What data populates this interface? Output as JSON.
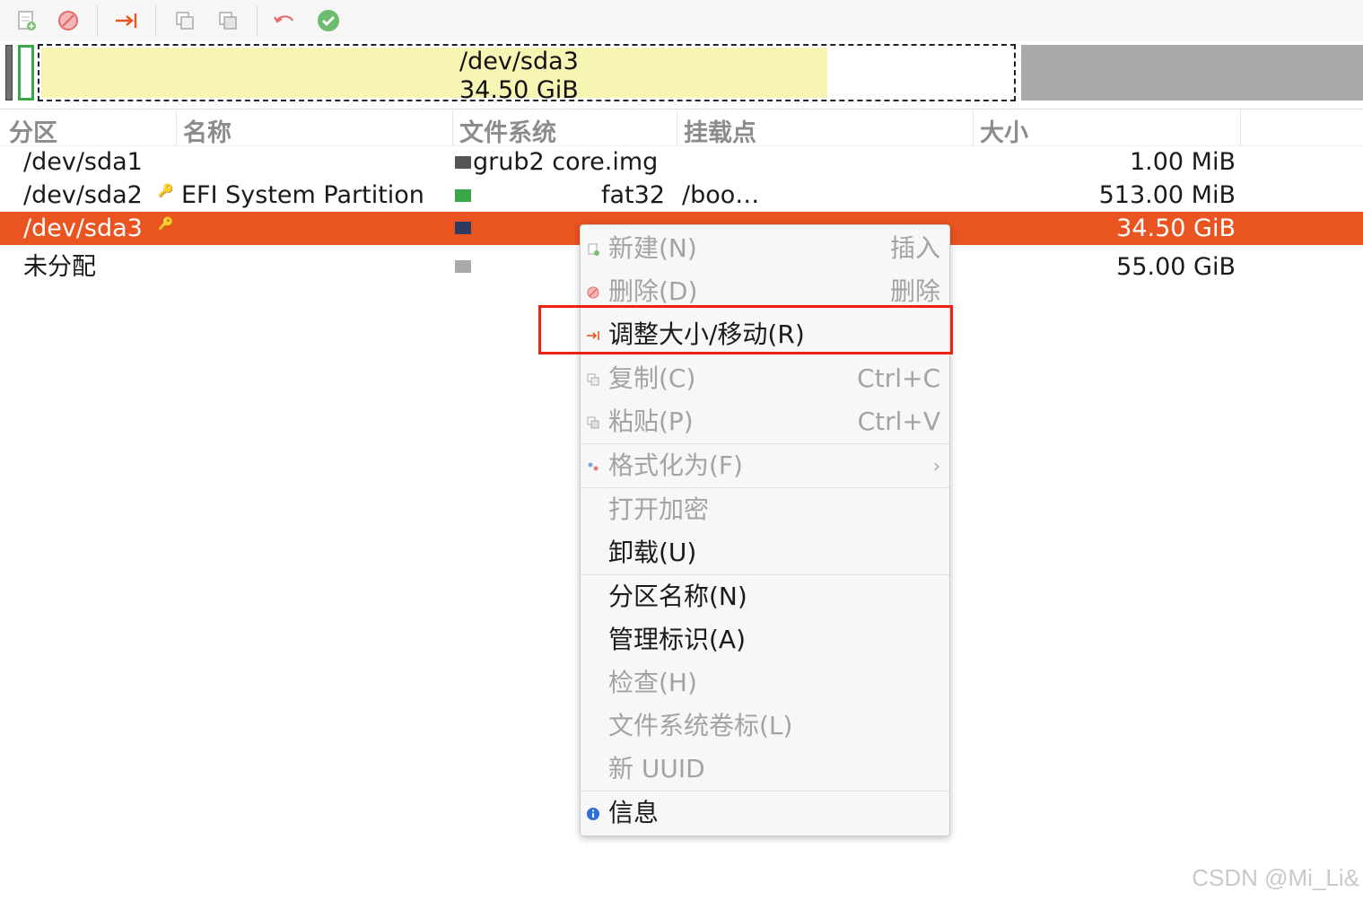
{
  "toolbar": {
    "buttons": [
      "new-partition",
      "delete-partition",
      "resize-move",
      "copy",
      "paste",
      "undo",
      "apply"
    ]
  },
  "partition_map": {
    "selected_name": "/dev/sda3",
    "selected_size": "34.50 GiB",
    "used_fraction": 0.81
  },
  "columns": [
    "分区",
    "名称",
    "文件系统",
    "挂载点",
    "大小"
  ],
  "rows": [
    {
      "partition": "/dev/sda1",
      "name": "",
      "filesystem": "grub2 core.img",
      "mount": "",
      "size": "1.00 MiB",
      "fs_color": "#555555"
    },
    {
      "partition": "/dev/sda2",
      "name": "EFI System Partition",
      "filesystem": "fat32",
      "mount": "/boo…",
      "size": "513.00 MiB",
      "fs_color": "#3aa64a"
    },
    {
      "partition": "/dev/sda3",
      "name": "",
      "filesystem": "",
      "mount": "",
      "size": "34.50 GiB",
      "fs_color": "#2d3b5f"
    },
    {
      "partition": "未分配",
      "name": "",
      "filesystem": "",
      "mount": "",
      "size": "55.00 GiB",
      "fs_color": "#a9a9a9"
    }
  ],
  "menu": {
    "items": [
      {
        "label": "新建(N)",
        "accel": "插入",
        "enabled": false
      },
      {
        "label": "删除(D)",
        "accel": "删除",
        "enabled": false
      },
      {
        "label": "调整大小/移动(R)",
        "accel": "",
        "enabled": true
      },
      {
        "label": "复制(C)",
        "accel": "Ctrl+C",
        "enabled": false
      },
      {
        "label": "粘贴(P)",
        "accel": "Ctrl+V",
        "enabled": false
      },
      {
        "label": "格式化为(F)",
        "accel": "›",
        "enabled": false
      },
      {
        "label": "打开加密",
        "accel": "",
        "enabled": false
      },
      {
        "label": "卸载(U)",
        "accel": "",
        "enabled": true
      },
      {
        "label": "分区名称(N)",
        "accel": "",
        "enabled": true
      },
      {
        "label": "管理标识(A)",
        "accel": "",
        "enabled": true
      },
      {
        "label": "检查(H)",
        "accel": "",
        "enabled": false
      },
      {
        "label": "文件系统卷标(L)",
        "accel": "",
        "enabled": false
      },
      {
        "label": "新 UUID",
        "accel": "",
        "enabled": false
      },
      {
        "label": "信息",
        "accel": "",
        "enabled": true
      }
    ]
  },
  "colors": {
    "selection": "#e95420",
    "highlight_box": "#ee2211",
    "used_space": "#f7f5b4",
    "unallocated": "#a9a9a9"
  },
  "watermark": "CSDN @Mi_Li&"
}
